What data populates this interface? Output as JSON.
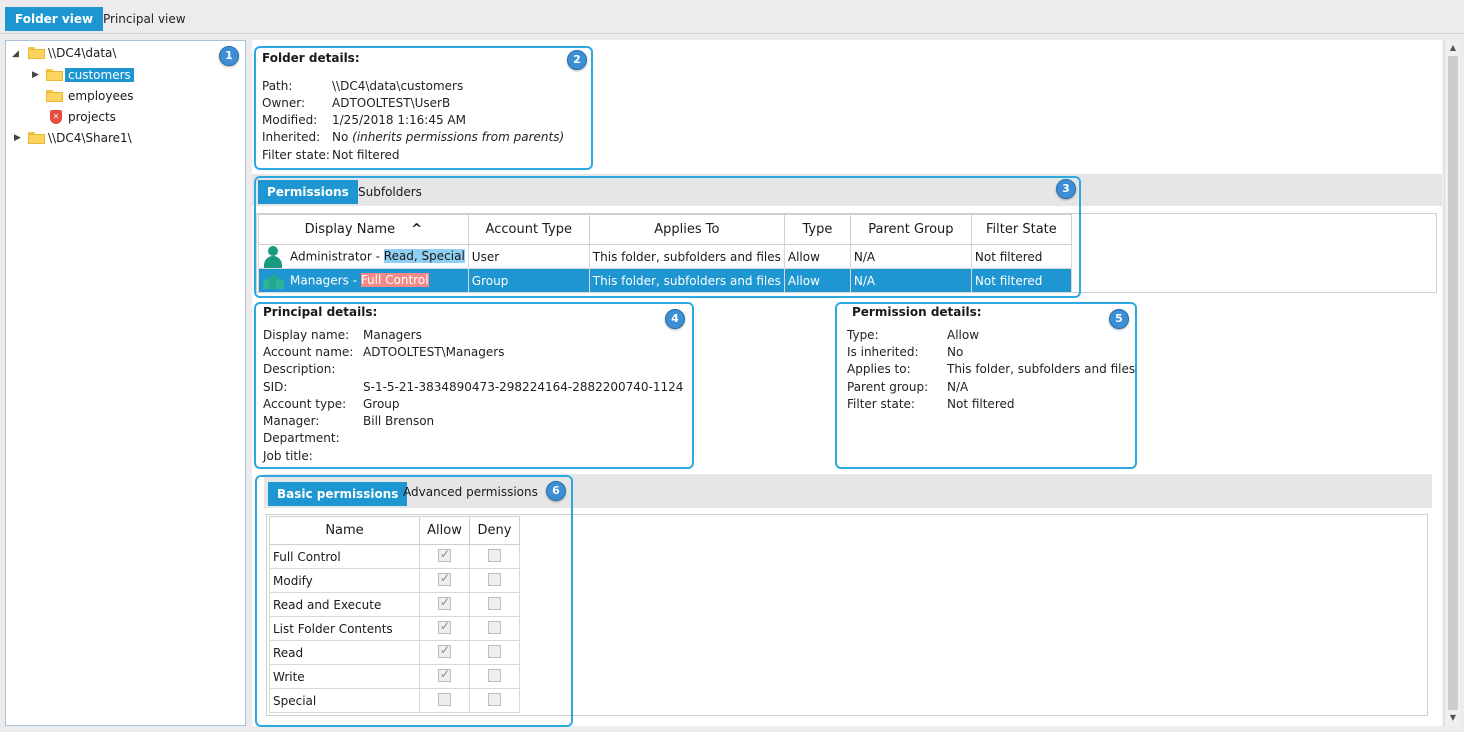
{
  "top_tabs": [
    {
      "label": "Folder view"
    },
    {
      "label": "Principal view"
    }
  ],
  "tree": {
    "items": [
      {
        "label": "\\\\DC4\\data\\"
      },
      {
        "label": "customers"
      },
      {
        "label": "employees"
      },
      {
        "label": "projects"
      },
      {
        "label": "\\\\DC4\\Share1\\"
      }
    ]
  },
  "badges": [
    "1",
    "2",
    "3",
    "4",
    "5",
    "6"
  ],
  "folder_details": {
    "title": "Folder details:",
    "labels": [
      "Path:",
      "Owner:",
      "Modified:",
      "Inherited:",
      "Filter state:"
    ],
    "path": "\\\\DC4\\data\\customers",
    "owner": "ADTOOLTEST\\UserB",
    "modified": "1/25/2018 1:16:45 AM",
    "inherited": "No",
    "inherited_note": "(inherits permissions from parents)",
    "filter_state": "Not filtered"
  },
  "permissions_tabs": [
    {
      "label": "Permissions"
    },
    {
      "label": "Subfolders"
    }
  ],
  "permissions_table": {
    "columns": [
      "Display Name",
      "Account Type",
      "Applies To",
      "Type",
      "Parent Group",
      "Filter State"
    ],
    "sort_indicator": "^",
    "rows": [
      {
        "name": "Administrator - ",
        "rights": "Read, Special",
        "account_type": "User",
        "applies_to": "This folder, subfolders and files",
        "type": "Allow",
        "parent_group": "N/A",
        "filter_state": "Not filtered"
      },
      {
        "name": "Managers - ",
        "rights": "Full Control",
        "account_type": "Group",
        "applies_to": "This folder, subfolders and files",
        "type": "Allow",
        "parent_group": "N/A",
        "filter_state": "Not filtered"
      }
    ]
  },
  "principal_details": {
    "title": "Principal details:",
    "labels": [
      "Display name:",
      "Account name:",
      "Description:",
      "SID:",
      "Account type:",
      "Manager:",
      "Department:",
      "Job title:"
    ],
    "values": [
      "Managers",
      "ADTOOLTEST\\Managers",
      "",
      "S-1-5-21-3834890473-298224164-2882200740-1124",
      "Group",
      "Bill Brenson",
      "",
      ""
    ]
  },
  "permission_details": {
    "title": "Permission details:",
    "labels": [
      "Type:",
      "Is inherited:",
      "Applies to:",
      "Parent group:",
      "Filter state:"
    ],
    "values": [
      "Allow",
      "No",
      "This folder, subfolders and files",
      "N/A",
      "Not filtered"
    ]
  },
  "basic_tabs": [
    {
      "label": "Basic permissions"
    },
    {
      "label": "Advanced permissions"
    }
  ],
  "basic_permissions": {
    "columns": [
      "Name",
      "Allow",
      "Deny"
    ],
    "rows": [
      {
        "name": "Full Control",
        "allow": true,
        "deny": false
      },
      {
        "name": "Modify",
        "allow": true,
        "deny": false
      },
      {
        "name": "Read and Execute",
        "allow": true,
        "deny": false
      },
      {
        "name": "List Folder Contents",
        "allow": true,
        "deny": false
      },
      {
        "name": "Read",
        "allow": true,
        "deny": false
      },
      {
        "name": "Write",
        "allow": true,
        "deny": false
      },
      {
        "name": "Special",
        "allow": false,
        "deny": false
      }
    ]
  },
  "colors": {
    "accent": "#1d96d2",
    "callout": "#2ea8e0",
    "badge": "#3c8fd4",
    "highlight_read": "#8fd0f2",
    "highlight_full": "#f28a8a"
  }
}
